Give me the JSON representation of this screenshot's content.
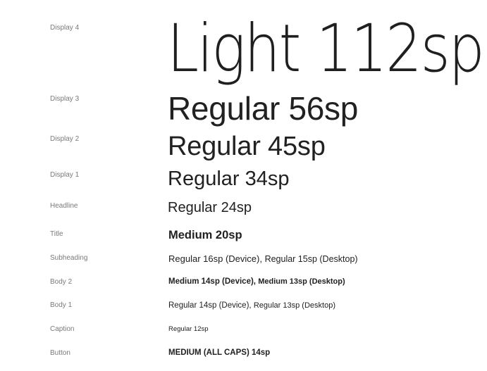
{
  "type_scale": {
    "colors": {
      "label": "#7a7a7a",
      "sample": "#212121",
      "background": "#ffffff"
    },
    "rows": [
      {
        "label": "Display 4",
        "sample": "Light 112sp"
      },
      {
        "label": "Display 3",
        "sample": "Regular 56sp"
      },
      {
        "label": "Display 2",
        "sample": "Regular 45sp"
      },
      {
        "label": "Display 1",
        "sample": "Regular 34sp"
      },
      {
        "label": "Headline",
        "sample": "Regular 24sp"
      },
      {
        "label": "Title",
        "sample": "Medium 20sp"
      },
      {
        "label": "Subheading",
        "sample": "Regular 16sp (Device), ",
        "sample_alt": "Regular 15sp (Desktop)"
      },
      {
        "label": "Body 2",
        "sample": "Medium 14sp (Device), ",
        "sample_alt": "Medium 13sp (Desktop)"
      },
      {
        "label": "Body 1",
        "sample": "Regular 14sp (Device), ",
        "sample_alt": "Regular 13sp (Desktop)"
      },
      {
        "label": "Caption",
        "sample": "Regular 12sp"
      },
      {
        "label": "Button",
        "sample": "MEDIUM (ALL CAPS) 14sp"
      }
    ]
  }
}
